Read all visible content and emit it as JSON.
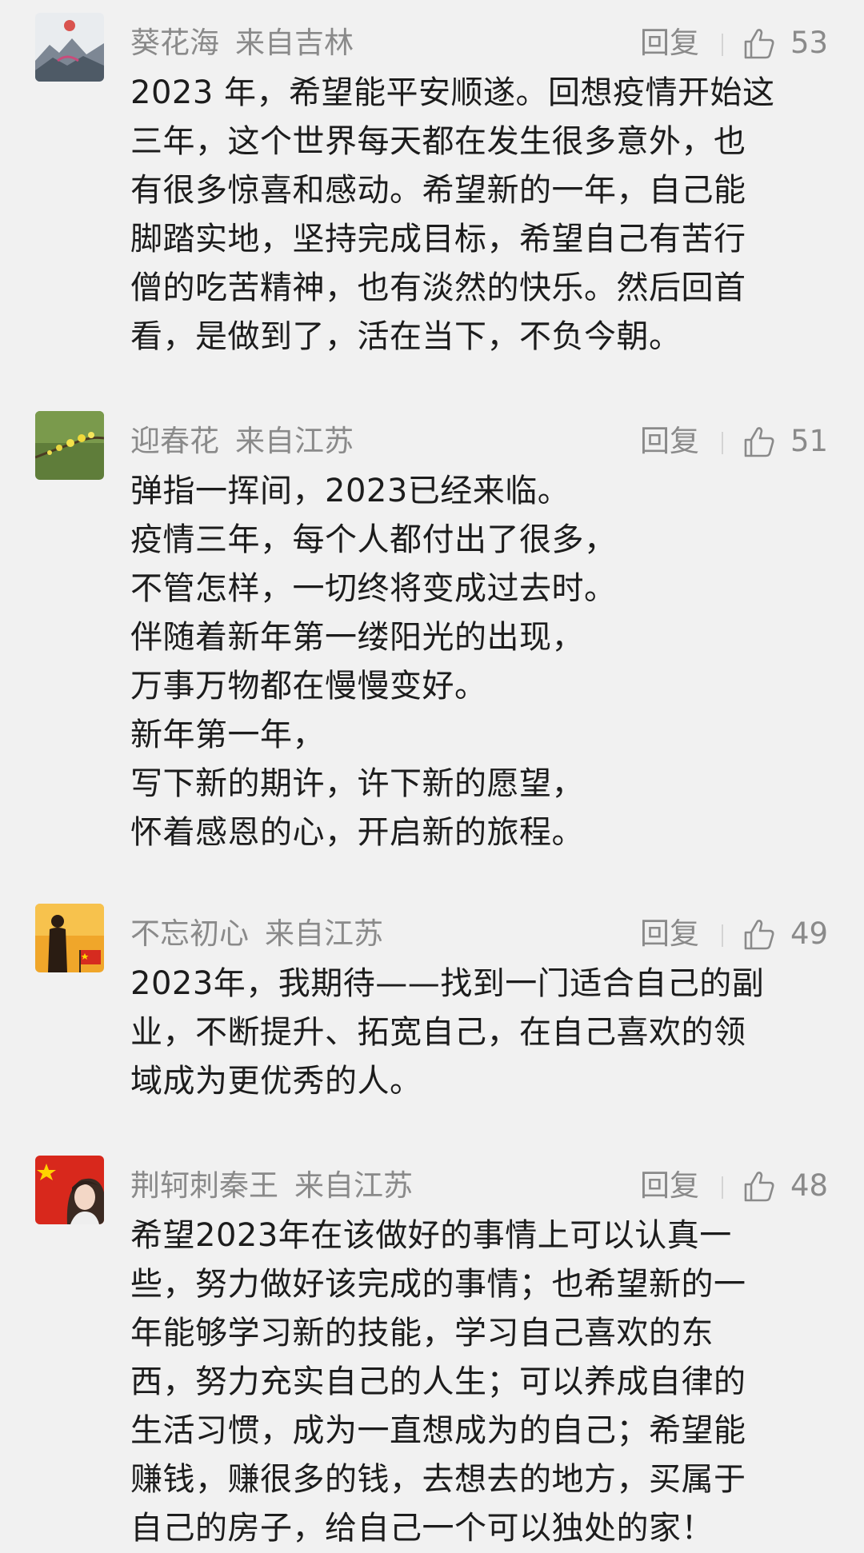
{
  "comments": [
    {
      "name": "葵花海",
      "location": "来自吉林",
      "reply_label": "回复",
      "likes": "53",
      "avatar_icon": "landscape-avatar-icon",
      "lines": [
        "2023 年，希望能平安顺遂。回想疫情开始这",
        "三年，这个世界每天都在发生很多意外，也",
        "有很多惊喜和感动。希望新的一年，自己能",
        "脚踏实地，坚持完成目标，希望自己有苦行",
        "僧的吃苦精神，也有淡然的快乐。然后回首",
        "看，是做到了，活在当下，不负今朝。"
      ]
    },
    {
      "name": "迎春花",
      "location": "来自江苏",
      "reply_label": "回复",
      "likes": "51",
      "avatar_icon": "flower-branch-avatar-icon",
      "lines": [
        "弹指一挥间，2023已经来临。",
        "疫情三年，每个人都付出了很多，",
        "不管怎样，一切终将变成过去时。",
        "伴随着新年第一缕阳光的出现，",
        "万事万物都在慢慢变好。",
        "新年第一年，",
        "写下新的期许，许下新的愿望，",
        "怀着感恩的心，开启新的旅程。"
      ]
    },
    {
      "name": "不忘初心",
      "location": "来自江苏",
      "reply_label": "回复",
      "likes": "49",
      "avatar_icon": "silhouette-flag-avatar-icon",
      "lines": [
        "2023年，我期待——找到一门适合自己的副",
        "业，不断提升、拓宽自己，在自己喜欢的领",
        "域成为更优秀的人。"
      ]
    },
    {
      "name": "荆轲刺秦王",
      "location": "来自江苏",
      "reply_label": "回复",
      "likes": "48",
      "avatar_icon": "girl-flag-avatar-icon",
      "lines": [
        "希望2023年在该做好的事情上可以认真一",
        "些，努力做好该完成的事情；也希望新的一",
        "年能够学习新的技能，学习自己喜欢的东",
        "西，努力充实自己的人生；可以养成自律的",
        "生活习惯，成为一直想成为的自己；希望能",
        "赚钱，赚很多的钱，去想去的地方，买属于",
        "自己的房子，给自己一个可以独处的家！"
      ]
    }
  ]
}
